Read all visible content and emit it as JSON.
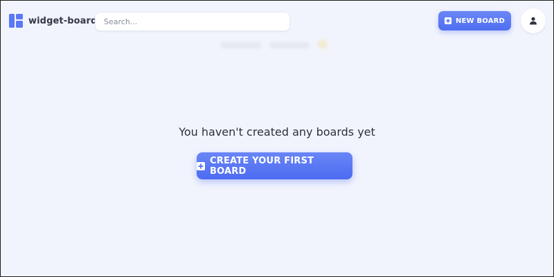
{
  "header": {
    "logo_text": "widget-board",
    "logo_icon": "board-logo-icon",
    "search": {
      "placeholder": "Search...",
      "value": "",
      "icon": "none"
    },
    "new_board_button": {
      "label": "NEW BOARD",
      "icon": "plus-square-icon"
    },
    "account_button": {
      "icon": "user-icon"
    }
  },
  "main": {
    "empty_message": "You haven't created any boards yet",
    "create_button": {
      "label": "CREATE YOUR FIRST BOARD",
      "icon": "plus-square-icon"
    }
  },
  "colors": {
    "background": "#f2f4fd",
    "accent": "#5673f3",
    "text_dark": "#2c303b",
    "logo": "#5b78f5"
  }
}
